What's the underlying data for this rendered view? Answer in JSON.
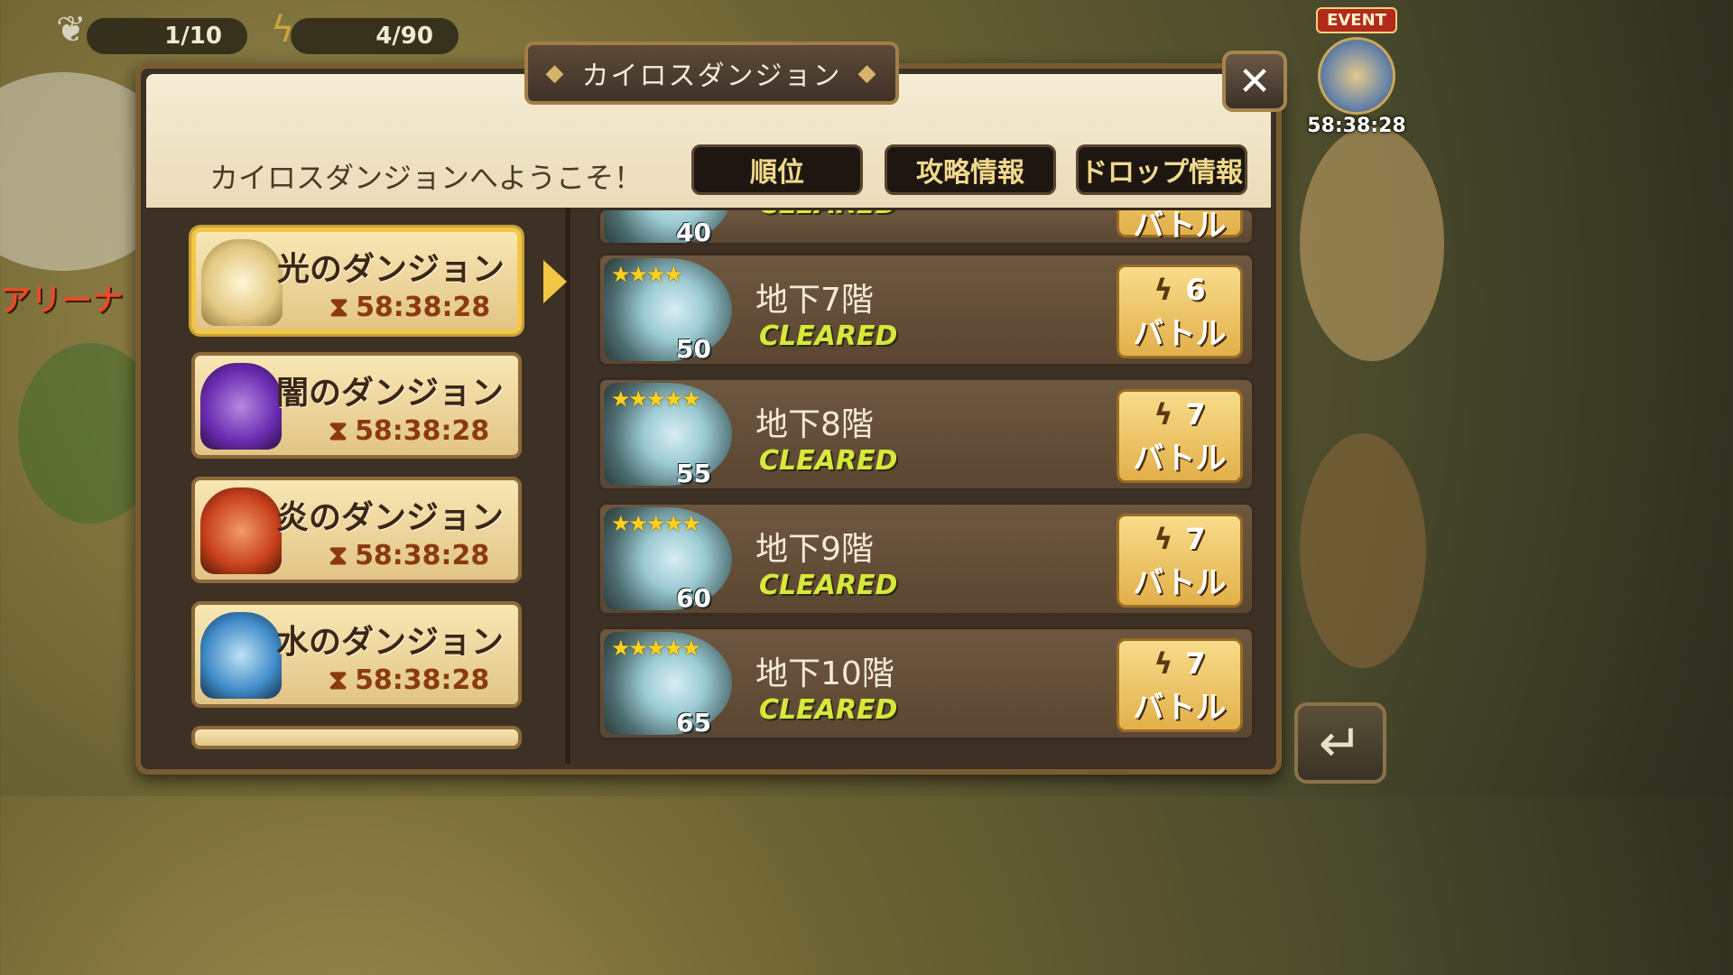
{
  "hud": {
    "wings_count": "1/10",
    "energy_count": "4/90"
  },
  "event": {
    "label": "EVENT",
    "timer": "58:38:28"
  },
  "map": {
    "arena_label": "アリーナ"
  },
  "dialog": {
    "title": "カイロスダンジョン",
    "welcome": "カイロスダンジョンへようこそ！",
    "buttons": [
      "順位",
      "攻略情報",
      "ドロップ情報"
    ],
    "close_label": "✕"
  },
  "dungeons": [
    {
      "name": "光のダンジョン",
      "timer": "58:38:28",
      "color": "#f0e2a0"
    },
    {
      "name": "闇のダンジョン",
      "timer": "58:38:28",
      "color": "#6a2bb0"
    },
    {
      "name": "炎のダンジョン",
      "timer": "58:38:28",
      "color": "#c8401c"
    },
    {
      "name": "水のダンジョン",
      "timer": "58:38:28",
      "color": "#3f8ac8"
    }
  ],
  "floors": [
    {
      "stars": "★★★★",
      "level": "40",
      "name": "",
      "status": "CLEARED",
      "cost": "",
      "battle": "バトル"
    },
    {
      "stars": "★★★★",
      "level": "50",
      "name": "地下7階",
      "status": "CLEARED",
      "cost": "6",
      "battle": "バトル"
    },
    {
      "stars": "★★★★★",
      "level": "55",
      "name": "地下8階",
      "status": "CLEARED",
      "cost": "7",
      "battle": "バトル"
    },
    {
      "stars": "★★★★★",
      "level": "60",
      "name": "地下9階",
      "status": "CLEARED",
      "cost": "7",
      "battle": "バトル"
    },
    {
      "stars": "★★★★★",
      "level": "65",
      "name": "地下10階",
      "status": "CLEARED",
      "cost": "7",
      "battle": "バトル"
    }
  ],
  "icons": {
    "wings": "wing-icon",
    "energy": "lightning-icon",
    "close": "close-icon",
    "back": "back-arrow-icon"
  }
}
